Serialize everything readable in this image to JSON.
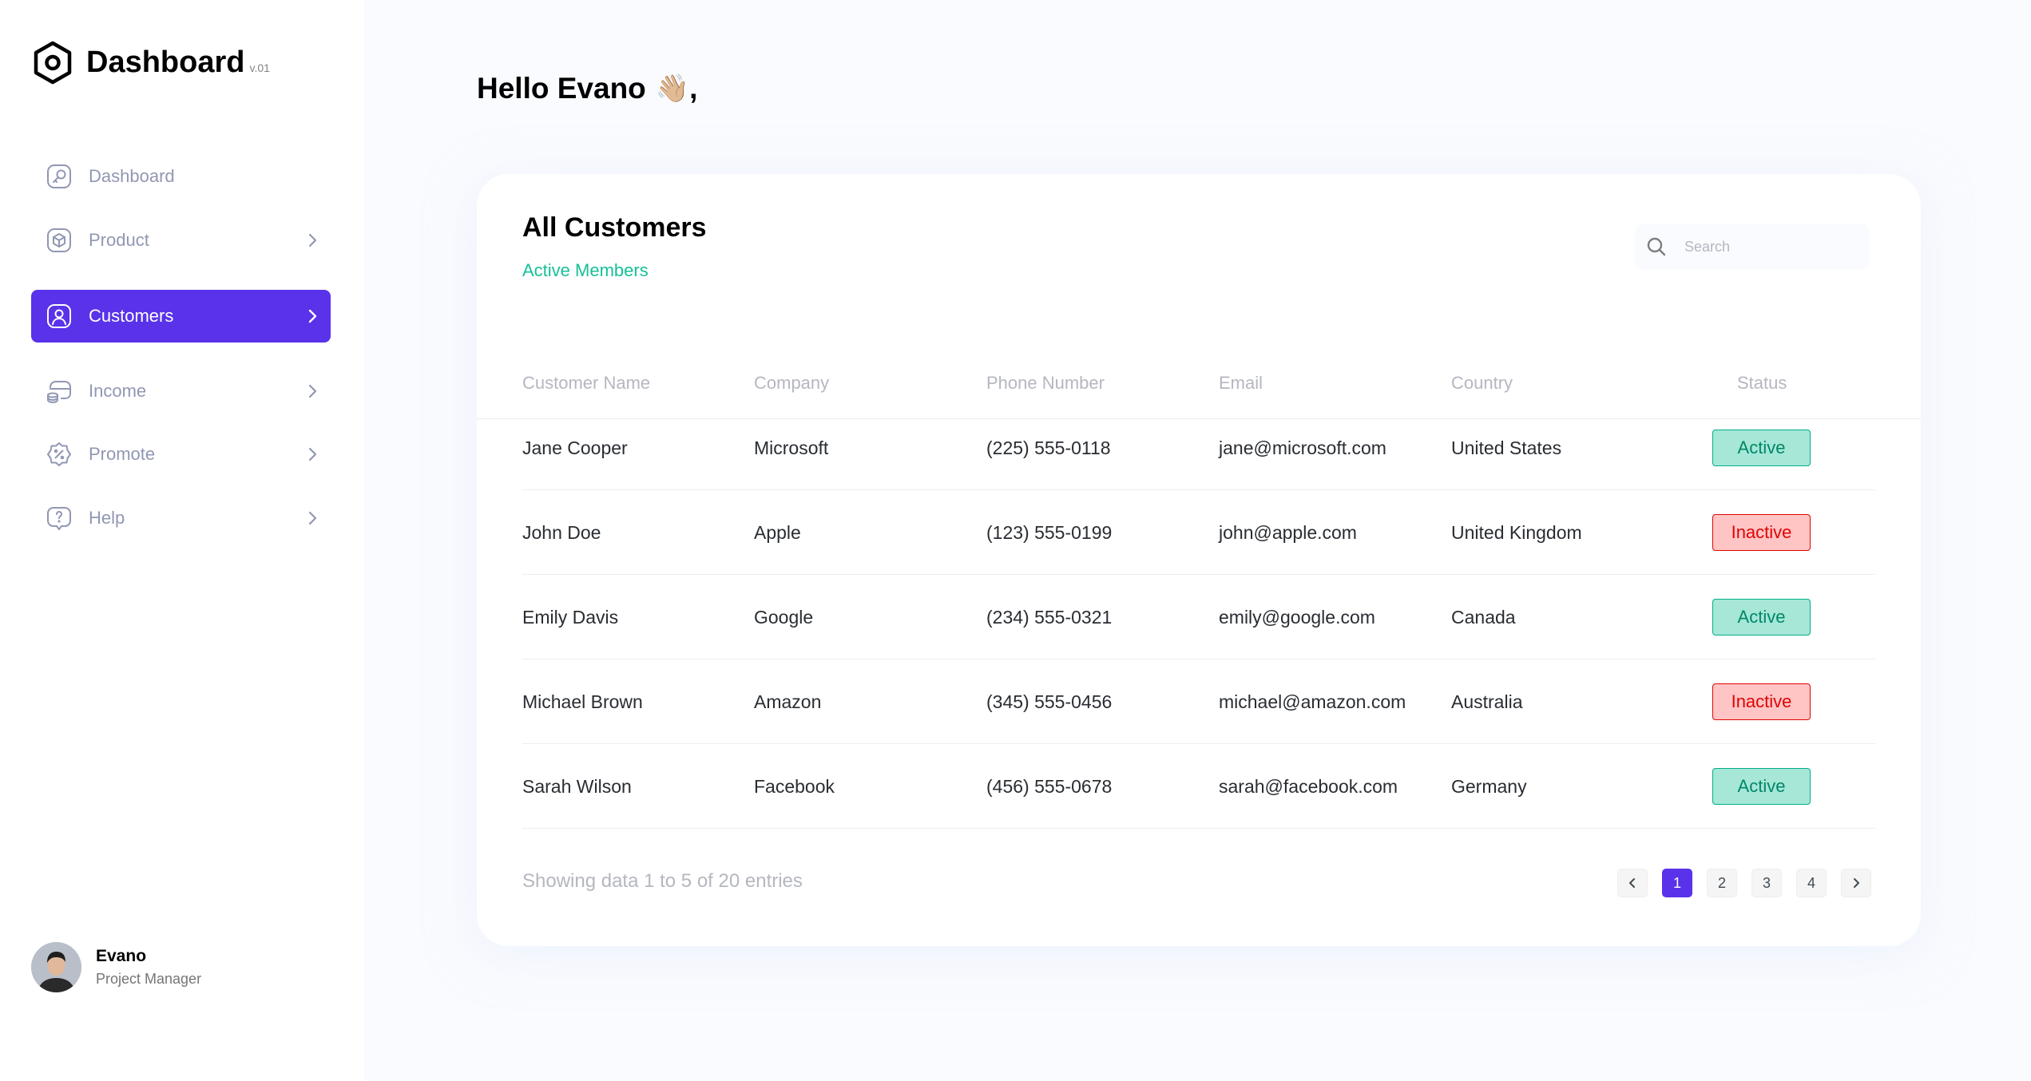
{
  "brand": {
    "name": "Dashboard",
    "version": "v.01"
  },
  "sidebar": {
    "items": [
      {
        "label": "Dashboard",
        "icon": "key-square-icon",
        "has_chevron": false,
        "active": false
      },
      {
        "label": "Product",
        "icon": "cube-icon",
        "has_chevron": true,
        "active": false
      },
      {
        "label": "Customers",
        "icon": "user-square-icon",
        "has_chevron": true,
        "active": true
      },
      {
        "label": "Income",
        "icon": "wallet-money-icon",
        "has_chevron": true,
        "active": false
      },
      {
        "label": "Promote",
        "icon": "discount-shape-icon",
        "has_chevron": true,
        "active": false
      },
      {
        "label": "Help",
        "icon": "message-question-icon",
        "has_chevron": true,
        "active": false
      }
    ]
  },
  "user": {
    "name": "Evano",
    "role": "Project Manager"
  },
  "greeting": {
    "text": "Hello Evano",
    "emoji": "👋🏼",
    "suffix": ","
  },
  "card": {
    "title": "All Customers",
    "subtitle": "Active Members",
    "search_placeholder": "Search"
  },
  "table": {
    "columns": [
      "Customer Name",
      "Company",
      "Phone Number",
      "Email",
      "Country",
      "Status"
    ],
    "rows": [
      {
        "name": "Jane Cooper",
        "company": "Microsoft",
        "phone": "(225) 555-0118",
        "email": "jane@microsoft.com",
        "country": "United States",
        "status": "Active"
      },
      {
        "name": "John Doe",
        "company": "Apple",
        "phone": "(123) 555-0199",
        "email": "john@apple.com",
        "country": "United Kingdom",
        "status": "Inactive"
      },
      {
        "name": "Emily Davis",
        "company": "Google",
        "phone": "(234) 555-0321",
        "email": "emily@google.com",
        "country": "Canada",
        "status": "Active"
      },
      {
        "name": "Michael Brown",
        "company": "Amazon",
        "phone": "(345) 555-0456",
        "email": "michael@amazon.com",
        "country": "Australia",
        "status": "Inactive"
      },
      {
        "name": "Sarah Wilson",
        "company": "Facebook",
        "phone": "(456) 555-0678",
        "email": "sarah@facebook.com",
        "country": "Germany",
        "status": "Active"
      }
    ]
  },
  "footer": {
    "showing_text": "Showing data 1 to 5 of 20 entries"
  },
  "pagination": {
    "pages": [
      "1",
      "2",
      "3",
      "4"
    ],
    "current": "1"
  },
  "colors": {
    "accent": "#5932EA",
    "subtitle_green": "#16C098",
    "active_bg": "#A6E7D8",
    "active_text": "#008767",
    "inactive_bg": "#FFC5C5",
    "inactive_text": "#DF0404"
  }
}
